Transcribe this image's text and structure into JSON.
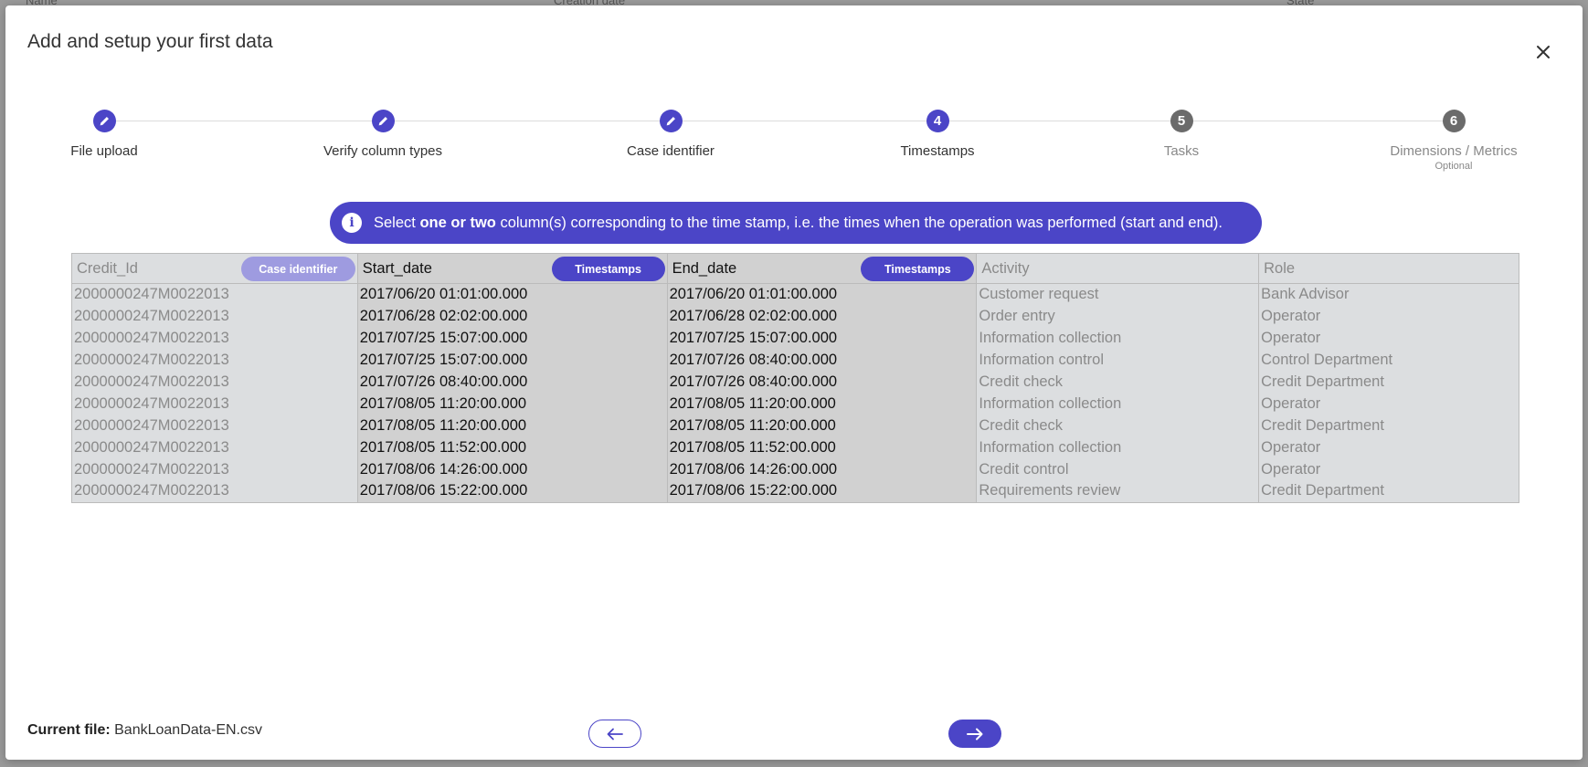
{
  "background": {
    "columns": [
      "Name",
      "Creation date",
      "State"
    ]
  },
  "modal": {
    "title": "Add and setup your first data",
    "close_icon": "close-icon"
  },
  "stepper": {
    "steps": [
      {
        "label": "File upload",
        "state": "done",
        "icon": "pencil-icon"
      },
      {
        "label": "Verify column types",
        "state": "done",
        "icon": "pencil-icon"
      },
      {
        "label": "Case identifier",
        "state": "done",
        "icon": "pencil-icon"
      },
      {
        "label": "Timestamps",
        "state": "active",
        "number": "4"
      },
      {
        "label": "Tasks",
        "state": "pending",
        "number": "5"
      },
      {
        "label": "Dimensions / Metrics",
        "state": "pending",
        "number": "6",
        "sublabel": "Optional"
      }
    ]
  },
  "banner": {
    "icon": "info-icon",
    "icon_glyph": "i",
    "text_before": "Select ",
    "text_bold": "one or two",
    "text_after": " column(s) corresponding to the time stamp, i.e. the times when the operation was performed (start and end)."
  },
  "table": {
    "columns": [
      {
        "name": "Credit_Id",
        "tag": "Case identifier",
        "tag_style": "muted",
        "selected": false
      },
      {
        "name": "Start_date",
        "tag": "Timestamps",
        "tag_style": "strong",
        "selected": true
      },
      {
        "name": "End_date",
        "tag": "Timestamps",
        "tag_style": "strong",
        "selected": true
      },
      {
        "name": "Activity",
        "tag": "",
        "selected": false
      },
      {
        "name": "Role",
        "tag": "",
        "selected": false
      }
    ],
    "rows": [
      [
        "2000000247M0022013",
        "2017/06/20 01:01:00.000",
        "2017/06/20 01:01:00.000",
        "Customer request",
        "Bank Advisor"
      ],
      [
        "2000000247M0022013",
        "2017/06/28 02:02:00.000",
        "2017/06/28 02:02:00.000",
        "Order entry",
        "Operator"
      ],
      [
        "2000000247M0022013",
        "2017/07/25 15:07:00.000",
        "2017/07/25 15:07:00.000",
        "Information collection",
        "Operator"
      ],
      [
        "2000000247M0022013",
        "2017/07/25 15:07:00.000",
        "2017/07/26 08:40:00.000",
        "Information control",
        "Control Department"
      ],
      [
        "2000000247M0022013",
        "2017/07/26 08:40:00.000",
        "2017/07/26 08:40:00.000",
        "Credit check",
        "Credit Department"
      ],
      [
        "2000000247M0022013",
        "2017/08/05 11:20:00.000",
        "2017/08/05 11:20:00.000",
        "Information collection",
        "Operator"
      ],
      [
        "2000000247M0022013",
        "2017/08/05 11:20:00.000",
        "2017/08/05 11:20:00.000",
        "Credit check",
        "Credit Department"
      ],
      [
        "2000000247M0022013",
        "2017/08/05 11:52:00.000",
        "2017/08/05 11:52:00.000",
        "Information collection",
        "Operator"
      ],
      [
        "2000000247M0022013",
        "2017/08/06 14:26:00.000",
        "2017/08/06 14:26:00.000",
        "Credit control",
        "Operator"
      ],
      [
        "2000000247M0022013",
        "2017/08/06 15:22:00.000",
        "2017/08/06 15:22:00.000",
        "Requirements review",
        "Credit Department"
      ]
    ]
  },
  "footer": {
    "current_file_label": "Current file:",
    "current_file_name": "BankLoanData-EN.csv",
    "prev_icon": "arrow-left-icon",
    "next_icon": "arrow-right-icon"
  },
  "colors": {
    "accent": "#4b45c7",
    "accent_muted": "#9e9be0",
    "pending": "#6b6b6b"
  }
}
